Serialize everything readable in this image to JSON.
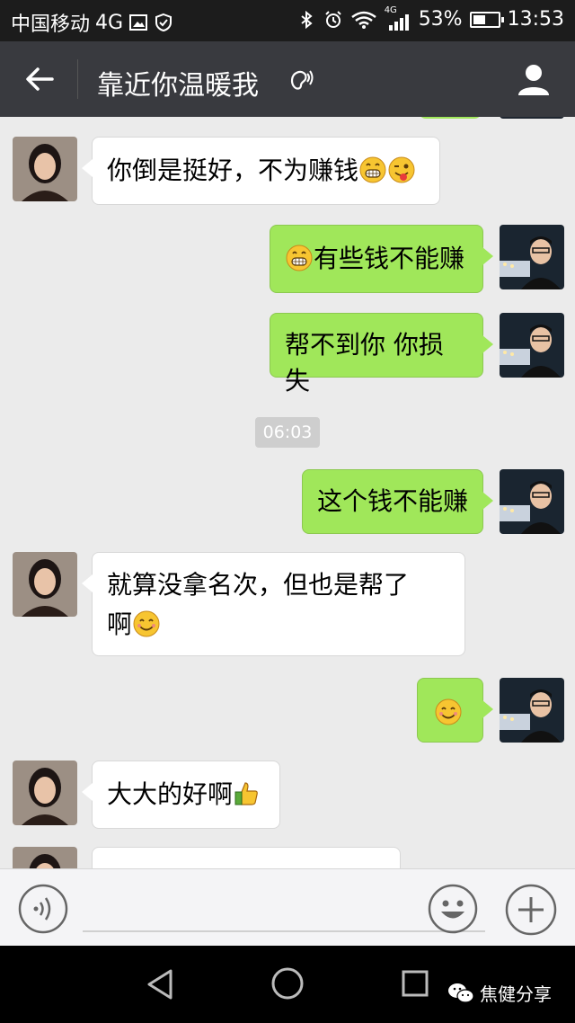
{
  "status_bar": {
    "carrier": "中国移动",
    "network": "4G",
    "signal_label": "4G",
    "battery": "53%",
    "battery_level": 0.53,
    "time": "13:53"
  },
  "header": {
    "title": "靠近你温暖我",
    "icons": [
      "back-arrow-icon",
      "earpiece-mode-icon",
      "person-icon"
    ]
  },
  "chat": {
    "timestamp": "06:03",
    "messages": [
      {
        "from": "other",
        "text": "你倒是挺好，不为赚钱",
        "emojis": [
          "grin",
          "wink-tongue"
        ]
      },
      {
        "from": "me",
        "text": "有些钱不能赚",
        "emojis_before": [
          "grin"
        ]
      },
      {
        "from": "me",
        "text": "帮不到你 你损失"
      },
      {
        "from": "me",
        "text": "这个钱不能赚"
      },
      {
        "from": "other",
        "line1": "就算没拿名次，但也是帮了",
        "line2": "啊",
        "emojis": [
          "smile"
        ]
      },
      {
        "from": "me",
        "text": "",
        "emojis": [
          "smile"
        ]
      },
      {
        "from": "other",
        "text": "大大的好啊",
        "emojis": [
          "thumbs-up"
        ]
      }
    ]
  },
  "input_bar": {
    "placeholder": "",
    "icons": [
      "voice-icon",
      "emoji-icon",
      "plus-icon"
    ]
  },
  "nav_bar": {
    "watermark": "焦健分享"
  },
  "colors": {
    "header_bg": "#393a3f",
    "chat_bg": "#ebebeb",
    "bubble_out": "#a0e75a",
    "bubble_in": "#ffffff"
  }
}
